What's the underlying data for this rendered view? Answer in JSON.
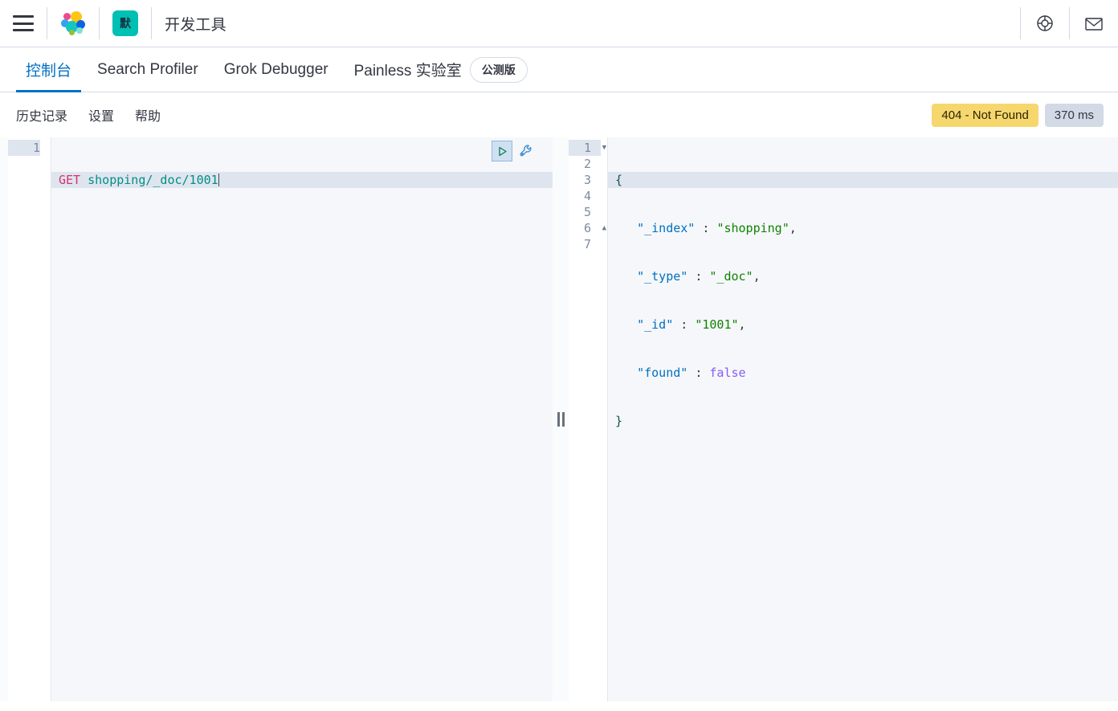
{
  "header": {
    "menu_icon": "hamburger-menu-icon",
    "logo_icon": "elastic-logo-icon",
    "space_badge": "默",
    "app_title": "开发工具",
    "help_icon": "help-life-ring-icon",
    "mail_icon": "mail-envelope-icon"
  },
  "tabs": [
    {
      "label": "控制台",
      "active": true
    },
    {
      "label": "Search Profiler",
      "active": false
    },
    {
      "label": "Grok Debugger",
      "active": false
    },
    {
      "label": "Painless 实验室",
      "active": false,
      "badge": "公测版"
    }
  ],
  "console_toolbar": {
    "links": [
      "历史记录",
      "设置",
      "帮助"
    ],
    "status": "404 - Not Found",
    "time": "370 ms",
    "status_color": "#f5d76e",
    "time_color": "#d3dae6"
  },
  "request_editor": {
    "line_numbers": [
      "1"
    ],
    "method": "GET",
    "path": "shopping/_doc/1001",
    "play_icon": "play-triangle-icon",
    "wrench_icon": "wrench-icon"
  },
  "response_editor": {
    "line_numbers": [
      "1",
      "2",
      "3",
      "4",
      "5",
      "6",
      "7"
    ],
    "lines": [
      {
        "text": "{",
        "type": "brace"
      },
      {
        "key": "\"_index\"",
        "value": "\"shopping\"",
        "comma": ","
      },
      {
        "key": "\"_type\"",
        "value": "\"_doc\"",
        "comma": ","
      },
      {
        "key": "\"_id\"",
        "value": "\"1001\"",
        "comma": ","
      },
      {
        "key": "\"found\"",
        "value": "false",
        "valueType": "bool",
        "comma": ""
      },
      {
        "text": "}",
        "type": "brace"
      },
      {
        "text": "",
        "type": "empty"
      }
    ],
    "raw": {
      "l1": "{",
      "l2_key": "\"_index\"",
      "l2_sep": " : ",
      "l2_val": "\"shopping\"",
      "l2_end": ",",
      "l3_key": "\"_type\"",
      "l3_sep": " : ",
      "l3_val": "\"_doc\"",
      "l3_end": ",",
      "l4_key": "\"_id\"",
      "l4_sep": " : ",
      "l4_val": "\"1001\"",
      "l4_end": ",",
      "l5_key": "\"found\"",
      "l5_sep": " : ",
      "l5_val": "false",
      "l6": "}"
    }
  },
  "resizer": {
    "icon": "grip-vertical-icon"
  },
  "theme": {
    "accent": "#0071c2",
    "teal": "#00bfb3",
    "border": "#d3dae6",
    "method": "#d6336c",
    "url": "#008f84",
    "json_key": "#0070c1",
    "json_string": "#118300",
    "json_bool": "#8a5cf5"
  }
}
